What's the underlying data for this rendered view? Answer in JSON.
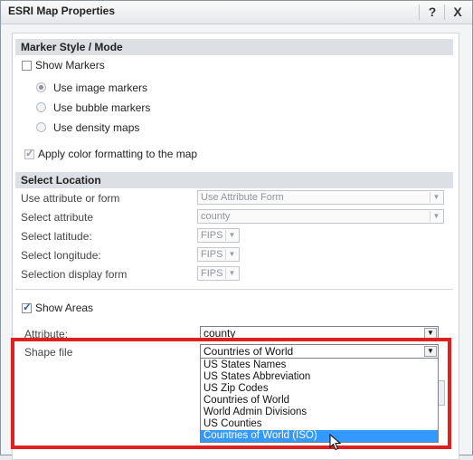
{
  "window": {
    "title": "ESRI Map Properties",
    "help_label": "?",
    "close_label": "X"
  },
  "marker_section": {
    "heading": "Marker Style / Mode",
    "show_markers": {
      "label": "Show Markers",
      "checked": false
    },
    "radios": [
      {
        "label": "Use image markers",
        "selected": true
      },
      {
        "label": "Use bubble markers",
        "selected": false
      },
      {
        "label": "Use density maps",
        "selected": false
      }
    ],
    "apply_color": {
      "label": "Apply color formatting to the map",
      "checked": true
    }
  },
  "location_section": {
    "heading": "Select Location",
    "rows": [
      {
        "label": "Use attribute or form",
        "value": "Use Attribute Form"
      },
      {
        "label": "Select attribute",
        "value": "county"
      },
      {
        "label": "Select latitude:",
        "value": "FIPS"
      },
      {
        "label": "Select longitude:",
        "value": "FIPS"
      },
      {
        "label": "Selection display form",
        "value": "FIPS"
      }
    ]
  },
  "areas_section": {
    "show_areas": {
      "label": "Show Areas",
      "checked": true
    },
    "attribute": {
      "label": "Attribute:",
      "value": "county"
    },
    "shape_file": {
      "label": "Shape file",
      "value": "Countries of World",
      "options": [
        "US States Names",
        "US States Abbreviation",
        "US Zip Codes",
        "Countries of World",
        "World Admin Divisions",
        "US Counties",
        "Countries of World (ISO)"
      ],
      "highlighted": "Countries of World (ISO)"
    }
  },
  "colors": {
    "highlight": "#e0201f",
    "selection": "#3399ff"
  }
}
